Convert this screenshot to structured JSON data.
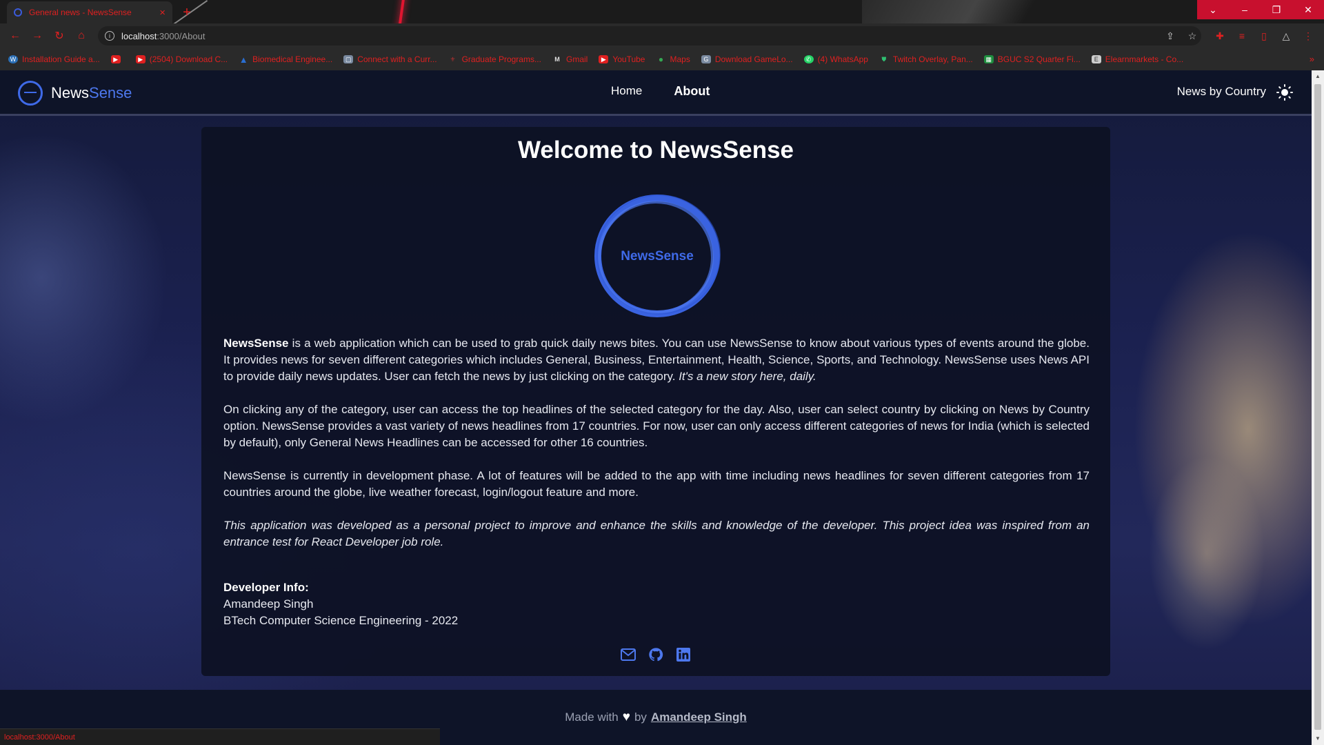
{
  "browser": {
    "tab_title": "General news - NewsSense",
    "tab_close": "×",
    "new_tab": "+",
    "url_host": "localhost",
    "url_path": ":3000/About",
    "bookmarks": [
      {
        "label": "Installation Guide a...",
        "icon": "wordpress-icon",
        "color": "#2b6fb6"
      },
      {
        "label": "",
        "icon": "youtube-icon",
        "color": "#e02020"
      },
      {
        "label": "(2504) Download C...",
        "icon": "youtube-icon",
        "color": "#e02020"
      },
      {
        "label": "Biomedical Enginee...",
        "icon": "atlassian-icon",
        "color": "#2a6ed1"
      },
      {
        "label": "Connect with a Curr...",
        "icon": "site-icon",
        "color": "#7a8aa0"
      },
      {
        "label": "Graduate Programs...",
        "icon": "university-icon",
        "color": "#b03030"
      },
      {
        "label": "Gmail",
        "icon": "gmail-icon",
        "color": "#e0e0e0"
      },
      {
        "label": "YouTube",
        "icon": "youtube-icon",
        "color": "#e02020"
      },
      {
        "label": "Maps",
        "icon": "maps-icon",
        "color": "#34a853"
      },
      {
        "label": "Download GameLo...",
        "icon": "site-icon",
        "color": "#7a8aa0"
      },
      {
        "label": "(4) WhatsApp",
        "icon": "whatsapp-icon",
        "color": "#25d366"
      },
      {
        "label": "Twitch Overlay, Pan...",
        "icon": "shield-icon",
        "color": "#2fbf71"
      },
      {
        "label": "BGUC S2 Quarter Fi...",
        "icon": "sheets-icon",
        "color": "#1e8e3e"
      },
      {
        "label": "Elearnmarkets - Co...",
        "icon": "site-icon",
        "color": "#cccccc"
      }
    ],
    "status_url": "localhost:3000/About"
  },
  "app": {
    "brand_main": "News",
    "brand_accent": "Sense",
    "nav": {
      "home": "Home",
      "about": "About",
      "country": "News by Country"
    }
  },
  "about": {
    "title": "Welcome to NewsSense",
    "logo_text": "NewsSense",
    "p1_strong": "NewsSense",
    "p1_text": " is a web application which can be used to grab quick daily news bites. You can use NewsSense to know about various types of events around the globe. It provides news for seven different categories which includes General, Business, Entertainment, Health, Science, Sports, and Technology. NewsSense uses News API to provide daily news updates. User can fetch the news by just clicking on the category. ",
    "p1_em": "It's a new story here, daily.",
    "p2": "On clicking any of the category, user can access the top headlines of the selected category for the day. Also, user can select country by clicking on News by Country option. NewsSense provides a vast variety of news headlines from 17 countries. For now, user can only access different categories of news for India (which is selected by default), only General News Headlines can be accessed for other 16 countries.",
    "p3": "NewsSense is currently in development phase. A lot of features will be added to the app with time including news headlines for seven different categories from 17 countries around the globe, live weather forecast, login/logout feature and more.",
    "p4": "This application was developed as a personal project to improve and enhance the skills and knowledge of the developer. This project idea was inspired from an entrance test for React Developer job role.",
    "dev_title": "Developer Info:",
    "dev_name": "Amandeep Singh",
    "dev_degree": "BTech Computer Science Engineering - 2022"
  },
  "footer": {
    "made_with": "Made with",
    "heart": "♥",
    "by": "by",
    "author": "Amandeep Singh"
  },
  "colors": {
    "accent": "#4d78ee",
    "nav_bg": "#0e1428",
    "browser_accent": "#e02020"
  }
}
